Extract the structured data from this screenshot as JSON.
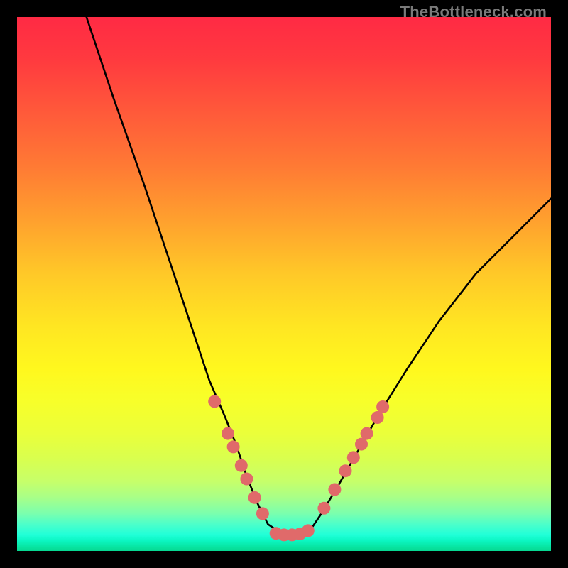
{
  "watermark": "TheBottleneck.com",
  "chart_data": {
    "type": "line",
    "title": "",
    "xlabel": "",
    "ylabel": "",
    "xlim": [
      0,
      100
    ],
    "ylim": [
      0,
      100
    ],
    "grid": false,
    "series": [
      {
        "name": "bottleneck-curve",
        "x": [
          13,
          18,
          24,
          29,
          33,
          36,
          39,
          41,
          43,
          45,
          47,
          50,
          53,
          55,
          57,
          60,
          64,
          68,
          73,
          79,
          86,
          94,
          100
        ],
        "values": [
          100,
          85,
          68,
          53,
          41,
          32,
          25,
          20,
          14,
          9,
          5,
          3,
          3,
          4,
          7,
          12,
          19,
          26,
          34,
          43,
          52,
          60,
          66
        ]
      }
    ],
    "markers": [
      {
        "name": "left-dot-1",
        "x": 37.0,
        "y": 28.0
      },
      {
        "name": "left-dot-2",
        "x": 39.5,
        "y": 22.0
      },
      {
        "name": "left-dot-3",
        "x": 40.5,
        "y": 19.5
      },
      {
        "name": "left-dot-4",
        "x": 42.0,
        "y": 16.0
      },
      {
        "name": "left-dot-5",
        "x": 43.0,
        "y": 13.5
      },
      {
        "name": "left-dot-6",
        "x": 44.5,
        "y": 10.0
      },
      {
        "name": "left-dot-7",
        "x": 46.0,
        "y": 7.0
      },
      {
        "name": "floor-dot-1",
        "x": 48.5,
        "y": 3.3
      },
      {
        "name": "floor-dot-2",
        "x": 50.0,
        "y": 3.0
      },
      {
        "name": "floor-dot-3",
        "x": 51.5,
        "y": 3.0
      },
      {
        "name": "floor-dot-4",
        "x": 53.0,
        "y": 3.2
      },
      {
        "name": "floor-dot-5",
        "x": 54.5,
        "y": 3.8
      },
      {
        "name": "right-dot-1",
        "x": 57.5,
        "y": 8.0
      },
      {
        "name": "right-dot-2",
        "x": 59.5,
        "y": 11.5
      },
      {
        "name": "right-dot-3",
        "x": 61.5,
        "y": 15.0
      },
      {
        "name": "right-dot-4",
        "x": 63.0,
        "y": 17.5
      },
      {
        "name": "right-dot-5",
        "x": 64.5,
        "y": 20.0
      },
      {
        "name": "right-dot-6",
        "x": 65.5,
        "y": 22.0
      },
      {
        "name": "right-dot-7",
        "x": 67.5,
        "y": 25.0
      },
      {
        "name": "right-dot-8",
        "x": 68.5,
        "y": 27.0
      }
    ],
    "marker_style": {
      "fill": "#e06a6a",
      "radius_pct": 1.2
    }
  }
}
